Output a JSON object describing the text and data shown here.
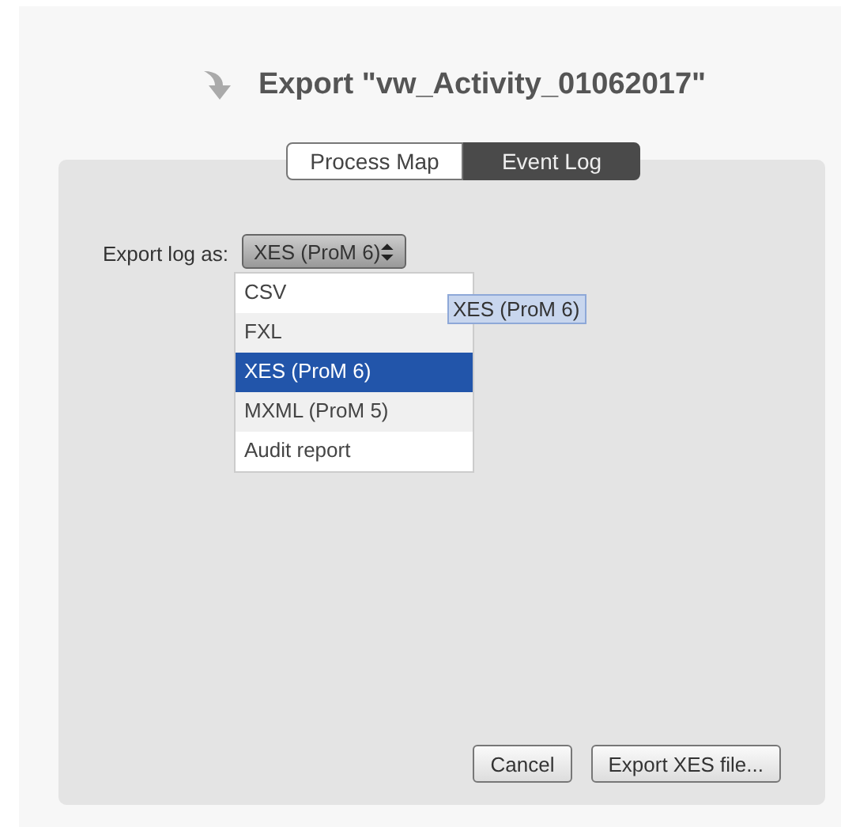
{
  "title": "Export \"vw_Activity_01062017\"",
  "tabs": [
    {
      "label": "Process Map",
      "selected": false
    },
    {
      "label": "Event Log",
      "selected": true
    }
  ],
  "export_format": {
    "label": "Export log as:",
    "value": "XES (ProM 6)",
    "expanded": true,
    "options": [
      {
        "label": "CSV",
        "selected": false
      },
      {
        "label": "FXL",
        "selected": false
      },
      {
        "label": "XES (ProM 6)",
        "selected": true
      },
      {
        "label": "MXML (ProM 5)",
        "selected": false
      },
      {
        "label": "Audit report",
        "selected": false
      }
    ],
    "tooltip": "XES (ProM 6)"
  },
  "buttons": [
    "Cancel",
    "Export XES file..."
  ]
}
